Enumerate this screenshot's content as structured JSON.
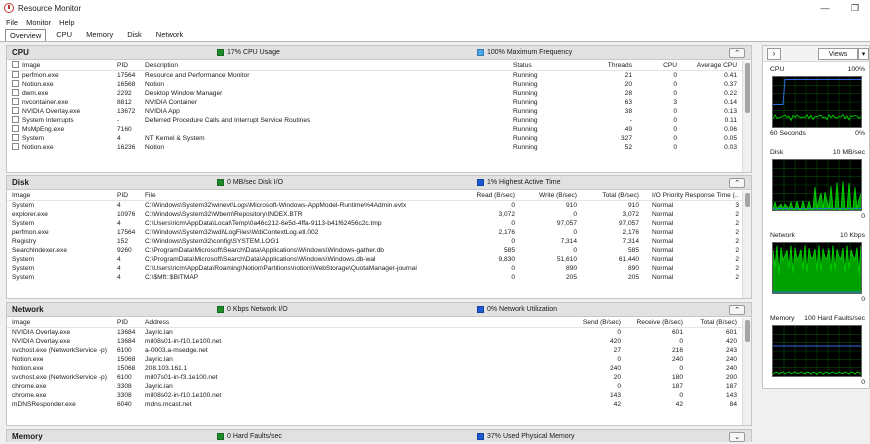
{
  "window": {
    "title": "Resource Monitor",
    "minimize": "—",
    "restore": "❐"
  },
  "menu": [
    "File",
    "Monitor",
    "Help"
  ],
  "tabs": [
    "Overview",
    "CPU",
    "Memory",
    "Disk",
    "Network"
  ],
  "colors": {
    "green": "#1e8c2a",
    "blue": "#1c59d6",
    "lightblue": "#4aa6e8",
    "graph_green": "#00c800",
    "graph_blue": "#2d6ee6"
  },
  "cpu": {
    "title": "CPU",
    "stat1": "17% CPU Usage",
    "stat2": "100% Maximum Frequency",
    "columns": [
      "Image",
      "PID",
      "Description",
      "Status",
      "Threads",
      "CPU",
      "Average CPU"
    ],
    "rows": [
      [
        "perfmon.exe",
        "17564",
        "Resource and Performance Monitor",
        "Running",
        "21",
        "0",
        "0.41"
      ],
      [
        "Notion.exe",
        "16568",
        "Notion",
        "Running",
        "20",
        "0",
        "0.37"
      ],
      [
        "dwm.exe",
        "2292",
        "Desktop Window Manager",
        "Running",
        "28",
        "0",
        "0.22"
      ],
      [
        "nvcontainer.exe",
        "8812",
        "NVIDIA Container",
        "Running",
        "63",
        "3",
        "0.14"
      ],
      [
        "NVIDIA Overlay.exe",
        "13672",
        "NVIDIA App",
        "Running",
        "38",
        "0",
        "0.13"
      ],
      [
        "System Interrupts",
        "-",
        "Deferred Procedure Calls and Interrupt Service Routines",
        "Running",
        "-",
        "0",
        "0.11"
      ],
      [
        "MsMpEng.exe",
        "7160",
        "",
        "Running",
        "49",
        "0",
        "0.06"
      ],
      [
        "System",
        "4",
        "NT Kernel & System",
        "Running",
        "327",
        "0",
        "0.05"
      ],
      [
        "Notion.exe",
        "16236",
        "Notion",
        "Running",
        "52",
        "0",
        "0.03"
      ]
    ]
  },
  "disk": {
    "title": "Disk",
    "stat1": "0 MB/sec Disk I/O",
    "stat2": "1% Highest Active Time",
    "columns": [
      "Image",
      "PID",
      "File",
      "Read (B/sec)",
      "Write (B/sec)",
      "Total (B/sec)",
      "I/O Priority",
      "Response Time (..."
    ],
    "rows": [
      [
        "System",
        "4",
        "C:\\Windows\\System32\\winevt\\Logs\\Microsoft-Windows-AppModel-Runtime%4Admin.evtx",
        "0",
        "910",
        "910",
        "Normal",
        "3"
      ],
      [
        "explorer.exe",
        "10976",
        "C:\\Windows\\System32\\Wbem\\Repository\\INDEX.BTR",
        "3,072",
        "0",
        "3,072",
        "Normal",
        "2"
      ],
      [
        "System",
        "4",
        "C:\\Users\\ricm\\AppData\\Local\\Temp\\0a46c212-6e5d-4ffa-9113-b41f62456c2c.tmp",
        "0",
        "97,057",
        "97,057",
        "Normal",
        "2"
      ],
      [
        "perfmon.exe",
        "17564",
        "C:\\Windows\\System32\\wdi\\LogFiles\\WdiContextLog.etl.002",
        "2,176",
        "0",
        "2,176",
        "Normal",
        "2"
      ],
      [
        "Registry",
        "152",
        "C:\\Windows\\System32\\config\\SYSTEM.LOG1",
        "0",
        "7,314",
        "7,314",
        "Normal",
        "2"
      ],
      [
        "SearchIndexer.exe",
        "9260",
        "C:\\ProgramData\\Microsoft\\Search\\Data\\Applications\\Windows\\Windows-gather.db",
        "585",
        "0",
        "585",
        "Normal",
        "2"
      ],
      [
        "System",
        "4",
        "C:\\ProgramData\\Microsoft\\Search\\Data\\Applications\\Windows\\Windows.db-wal",
        "9,830",
        "51,610",
        "61,440",
        "Normal",
        "2"
      ],
      [
        "System",
        "4",
        "C:\\Users\\ricm\\AppData\\Roaming\\Notion\\Partitions\\notion\\WebStorage\\QuotaManager-journal",
        "0",
        "890",
        "890",
        "Normal",
        "2"
      ],
      [
        "System",
        "4",
        "C:\\$Mft::$BITMAP",
        "0",
        "205",
        "205",
        "Normal",
        "2"
      ]
    ]
  },
  "network": {
    "title": "Network",
    "stat1": "0 Kbps Network I/O",
    "stat2": "0% Network Utilization",
    "columns": [
      "Image",
      "PID",
      "Address",
      "Send (B/sec)",
      "Receive (B/sec)",
      "Total (B/sec)"
    ],
    "rows": [
      [
        "NVIDIA Overlay.exe",
        "13684",
        "Jayric.lan",
        "0",
        "601",
        "601"
      ],
      [
        "NVIDIA Overlay.exe",
        "13684",
        "mil08s01-in-f10.1e100.net",
        "420",
        "0",
        "420"
      ],
      [
        "svchost.exe (NetworkService -p)",
        "6100",
        "a-0003.a-msedge.net",
        "27",
        "216",
        "243"
      ],
      [
        "Notion.exe",
        "15068",
        "Jayric.lan",
        "0",
        "240",
        "240"
      ],
      [
        "Notion.exe",
        "15068",
        "208.103.161.1",
        "240",
        "0",
        "240"
      ],
      [
        "svchost.exe (NetworkService -p)",
        "6100",
        "mil07s01-in-f3.1e100.net",
        "20",
        "180",
        "200"
      ],
      [
        "chrome.exe",
        "3308",
        "Jayric.lan",
        "0",
        "187",
        "187"
      ],
      [
        "chrome.exe",
        "3308",
        "mil08s02-in-f10.1e100.net",
        "143",
        "0",
        "143"
      ],
      [
        "mDNSResponder.exe",
        "6040",
        "mdns.mcast.net",
        "42",
        "42",
        "84"
      ]
    ]
  },
  "memory": {
    "title": "Memory",
    "stat1": "0 Hard Faults/sec",
    "stat2": "37% Used Physical Memory"
  },
  "side": {
    "views_label": "Views",
    "graphs": [
      {
        "name": "CPU",
        "max": "100%",
        "footer_left": "60 Seconds",
        "footer_right": "0%"
      },
      {
        "name": "Disk",
        "max": "10 MB/sec",
        "footer_left": "",
        "footer_right": "0"
      },
      {
        "name": "Network",
        "max": "10 Kbps",
        "footer_left": "",
        "footer_right": "0"
      },
      {
        "name": "Memory",
        "max": "100 Hard Faults/sec",
        "footer_left": "",
        "footer_right": "0"
      }
    ]
  }
}
